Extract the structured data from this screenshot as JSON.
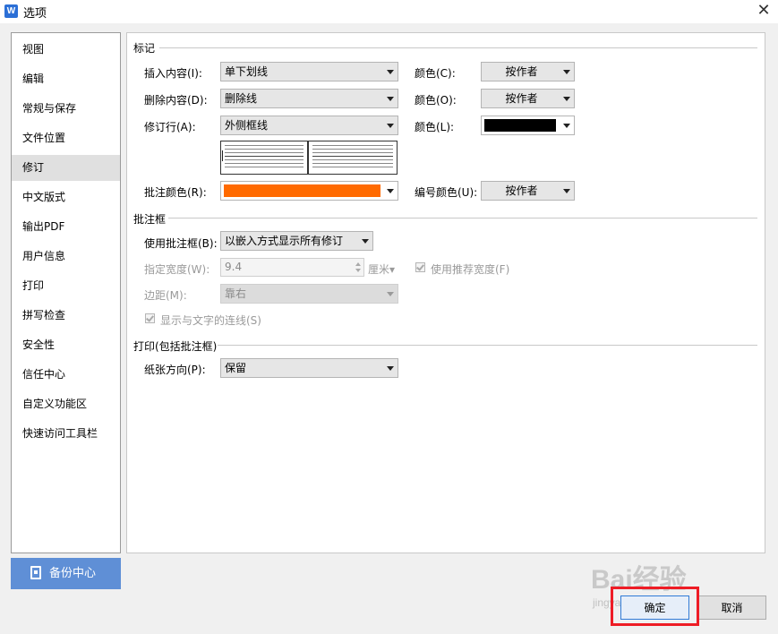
{
  "window": {
    "title": "选项",
    "app_icon": "W",
    "close_icon": "close-icon"
  },
  "sidebar": {
    "items": [
      {
        "label": "视图"
      },
      {
        "label": "编辑"
      },
      {
        "label": "常规与保存"
      },
      {
        "label": "文件位置"
      },
      {
        "label": "修订",
        "active": true
      },
      {
        "label": "中文版式"
      },
      {
        "label": "输出PDF"
      },
      {
        "label": "用户信息"
      },
      {
        "label": "打印"
      },
      {
        "label": "拼写检查"
      },
      {
        "label": "安全性"
      },
      {
        "label": "信任中心"
      },
      {
        "label": "自定义功能区"
      },
      {
        "label": "快速访问工具栏"
      }
    ],
    "backup_button": "备份中心"
  },
  "markup": {
    "section_title": "标记",
    "insert_label": "插入内容(I):",
    "insert_value": "单下划线",
    "insert_color_label": "颜色(C):",
    "insert_color_value": "按作者",
    "delete_label": "删除内容(D):",
    "delete_value": "删除线",
    "delete_color_label": "颜色(O):",
    "delete_color_value": "按作者",
    "changed_lines_label": "修订行(A):",
    "changed_lines_value": "外侧框线",
    "changed_lines_color_label": "颜色(L):",
    "changed_lines_color": "#000000",
    "comment_color_label": "批注颜色(R):",
    "comment_color": "#ff6a00",
    "numbering_color_label": "编号颜色(U):",
    "numbering_color_value": "按作者"
  },
  "balloons": {
    "section_title": "批注框",
    "use_label": "使用批注框(B):",
    "use_value": "以嵌入方式显示所有修订",
    "width_label": "指定宽度(W):",
    "width_value": "9.4",
    "width_unit": "厘米",
    "recommended_width_label": "使用推荐宽度(F)",
    "margin_label": "边距(M):",
    "margin_value": "靠右",
    "show_lines_label": "显示与文字的连线(S)"
  },
  "printing": {
    "section_title": "打印(包括批注框)",
    "orientation_label": "纸张方向(P):",
    "orientation_value": "保留"
  },
  "footer": {
    "ok_label": "确定",
    "cancel_label": "取消"
  },
  "watermark": {
    "text": "Bai经验",
    "sub": "jingyan.baidu.com"
  },
  "colors": {
    "accent": "#2f7ad7",
    "highlight_box": "#ee1c25",
    "backup_button": "#5f8fd6"
  }
}
